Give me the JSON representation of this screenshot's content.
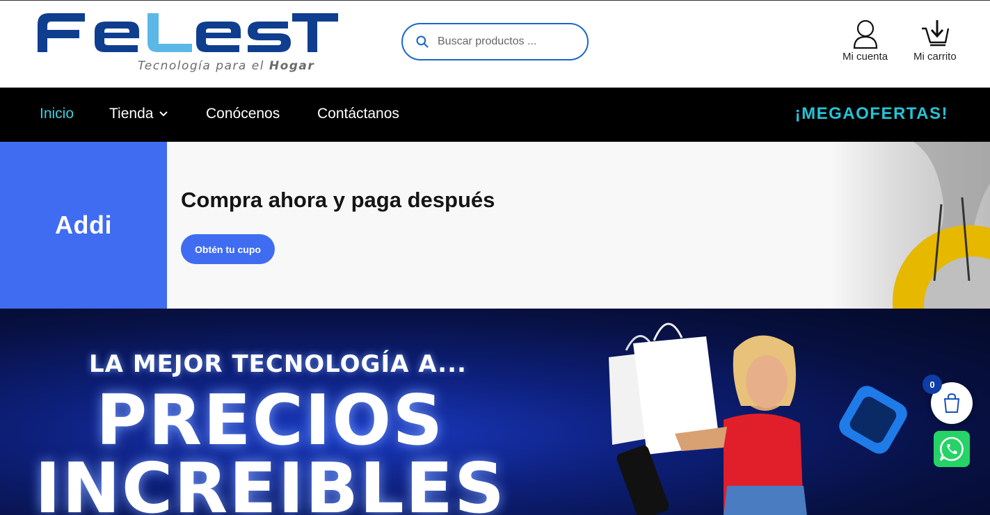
{
  "header": {
    "logo_text": "FELEST",
    "logo_tagline": "Tecnología para el",
    "logo_tagline_bold": "Hogar",
    "search_placeholder": "Buscar productos ...",
    "account_label": "Mi cuenta",
    "cart_label": "Mi carrito"
  },
  "nav": {
    "items": [
      {
        "label": "Inicio",
        "active": true
      },
      {
        "label": "Tienda",
        "has_dropdown": true
      },
      {
        "label": "Conócenos"
      },
      {
        "label": "Contáctanos"
      }
    ],
    "promo_label": "¡MEGAOFERTAS!"
  },
  "addi_banner": {
    "brand": "Addi",
    "headline": "Compra ahora y paga después",
    "button_label": "Obtén tu cupo"
  },
  "hero": {
    "line1": "LA MEJOR TECNOLOGÍA A...",
    "line2": "PRECIOS",
    "line3": "INCREIBLES"
  },
  "floating": {
    "cart_count": "0"
  },
  "colors": {
    "brand_blue": "#0f3e8f",
    "brand_light_blue": "#5bb8e6",
    "nav_active": "#3ad0e0",
    "promo": "#25c3d6",
    "addi_blue": "#3f6cf1",
    "whatsapp": "#25d366"
  },
  "icons": [
    "search-icon",
    "user-icon",
    "cart-download-icon",
    "chevron-down-icon",
    "shopping-bag-icon",
    "whatsapp-icon"
  ]
}
